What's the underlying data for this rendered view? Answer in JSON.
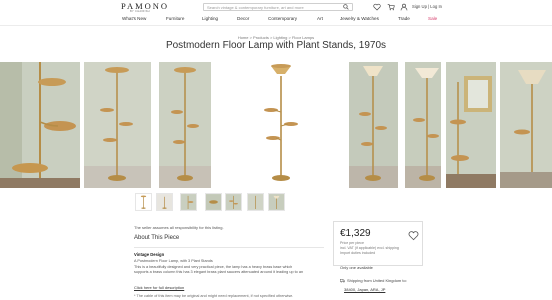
{
  "header": {
    "logo": "PAMONO",
    "logo_sub": "BY CHAIRISH",
    "search_placeholder": "Search vintage & contemporary furniture, art and more",
    "signup": "Sign Up | Log In"
  },
  "nav": [
    {
      "label": "What's New"
    },
    {
      "label": "Furniture"
    },
    {
      "label": "Lighting"
    },
    {
      "label": "Decor"
    },
    {
      "label": "Contemporary"
    },
    {
      "label": "Art"
    },
    {
      "label": "Jewelry & Watches"
    },
    {
      "label": "Trade"
    },
    {
      "label": "Sale"
    }
  ],
  "breadcrumb": "Home > Products > Lighting > Floor Lamps",
  "title": "Postmodern Floor Lamp with Plant Stands, 1970s",
  "product": {
    "note": "The seller assumes all responsibility for this listing.",
    "section_title": "About This Piece",
    "sub_title": "Vintage Design",
    "desc_lines": [
      "A Postmodern Floor Lamp, with 3 Plant Stands",
      "This is a beautifully designed and very practical piece, the lamp has a heavy brass base which",
      "supports a brass column this has 3 elegant brass plant saucers attenuated around it leading up to an"
    ],
    "read_more": "Click here for full description",
    "footnote": "* The cable of this item may be original and might need replacement, if not specified otherwise."
  },
  "purchase": {
    "price": "€1,329",
    "price_per": "Price per piece",
    "vat": "incl. VAT (if applicable) excl. shipping",
    "import": "Import duties included",
    "availability": "Only one available",
    "shipping": "Shipping from United Kingdom to:",
    "postcode": "38400, Japan, ARA, JP"
  },
  "colors": {
    "accent_sale": "#d63c6b",
    "brass": "#b58d47",
    "wall_green": "#c9cfc0"
  }
}
